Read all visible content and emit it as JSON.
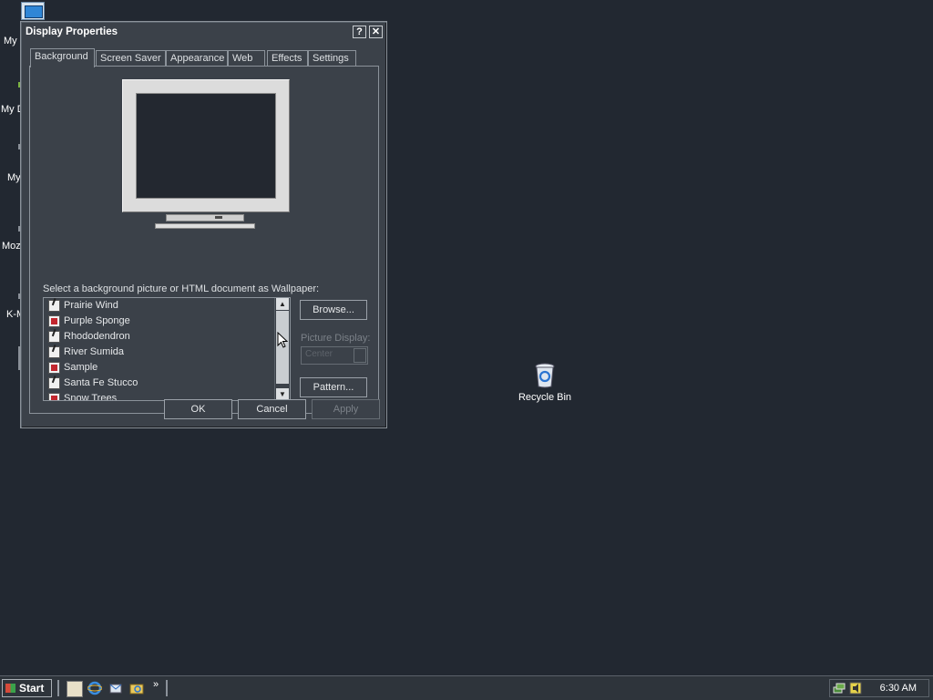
{
  "desktop": {
    "icon_labels": [
      "My",
      "My D",
      "My",
      "Moz",
      "K-M"
    ],
    "recycle_bin": "Recycle Bin"
  },
  "window": {
    "title": "Display Properties",
    "help_glyph": "?",
    "close_glyph": "✕",
    "tabs": [
      "Background",
      "Screen Saver",
      "Appearance",
      "Web",
      "Effects",
      "Settings"
    ],
    "active_tab": "Background",
    "prompt": "Select a background picture or HTML document as Wallpaper:",
    "wallpapers": [
      {
        "label": "Prairie Wind",
        "icon": "palm-icon"
      },
      {
        "label": "Purple Sponge",
        "icon": "picture-icon"
      },
      {
        "label": "Rhododendron",
        "icon": "palm-icon"
      },
      {
        "label": "River Sumida",
        "icon": "palm-icon"
      },
      {
        "label": "Sample",
        "icon": "picture-icon"
      },
      {
        "label": "Santa Fe Stucco",
        "icon": "palm-icon"
      },
      {
        "label": "Snow Trees",
        "icon": "picture-icon"
      }
    ],
    "browse": "Browse...",
    "picture_display_label": "Picture Display:",
    "picture_display_value": "Center",
    "pattern": "Pattern...",
    "ok": "OK",
    "cancel": "Cancel",
    "apply": "Apply"
  },
  "taskbar": {
    "start": "Start",
    "chevron": "»",
    "clock": "6:30 AM"
  }
}
